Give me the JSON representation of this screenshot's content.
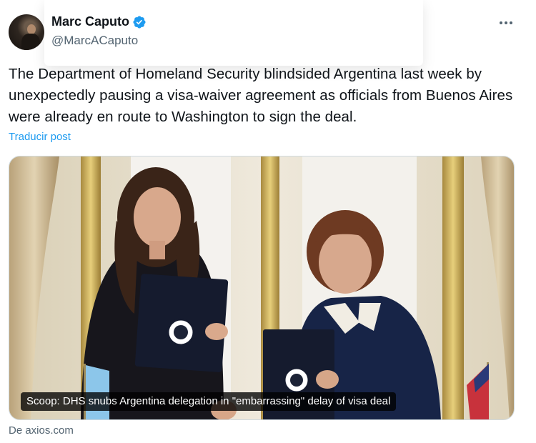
{
  "author": {
    "display_name": "Marc Caputo",
    "handle": "@MarcACaputo",
    "verified": true
  },
  "icons": {
    "verified": "verified-badge-icon",
    "more": "more-options-icon"
  },
  "colors": {
    "link": "#1d9bf0",
    "verified": "#1d9bf0",
    "secondary_text": "#536471"
  },
  "tweet": {
    "text": "The Department of Homeland Security blindsided Argentina last week by unexpectedly pausing a visa-waiver agreement as officials from Buenos Aires were already en route to Washington to sign the deal.",
    "translate_label": "Traducir post"
  },
  "media": {
    "caption": "Scoop: DHS snubs Argentina delegation in \"embarrassing\" delay of visa deal",
    "source": "De axios.com"
  }
}
